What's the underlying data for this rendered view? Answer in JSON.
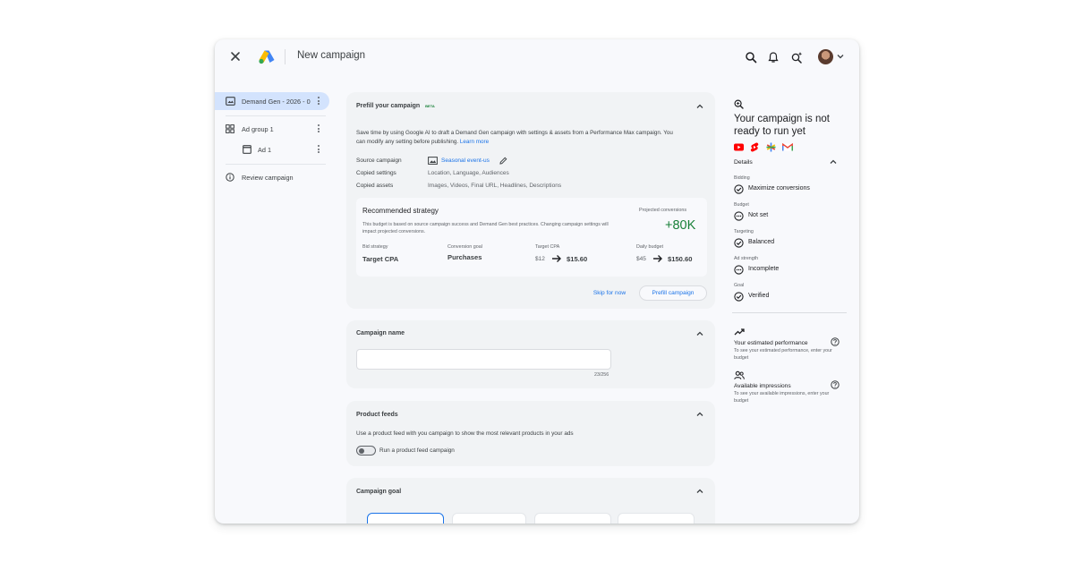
{
  "app": {
    "title": "New campaign"
  },
  "nav": {
    "items": [
      {
        "label": "Demand Gen - 2026 - 0",
        "active": true
      },
      {
        "label": "Ad group 1"
      },
      {
        "label": "Ad 1"
      },
      {
        "label": "Review campaign"
      }
    ]
  },
  "prefill": {
    "title": "Prefill your campaign",
    "badge": "BETA",
    "description": "Save time by using Google AI to draft a Demand Gen campaign with settings & assets from a Performance Max campaign. You can modify any setting before publishing.",
    "learn_more": "Learn more",
    "rows": [
      {
        "key": "Source campaign",
        "value": "Seasonal event-us"
      },
      {
        "key": "Copied settings",
        "value": "Location, Language, Audiences"
      },
      {
        "key": "Copied assets",
        "value": "Images, Videos, Final URL, Headlines, Descriptions"
      }
    ],
    "strategy": {
      "title": "Recommended strategy",
      "description": "This budget is based on source campaign success and Demand Gen best practices. Changing campaign settings will impact projected conversions.",
      "projected_label": "Projected conversions",
      "projected_value": "+80K",
      "bid_strategy_label": "Bid strategy",
      "bid_strategy_value": "Target CPA",
      "conversion_goal_label": "Conversion goal",
      "conversion_goal_value": "Purchases",
      "target_cpa_label": "Target CPA",
      "target_cpa_old": "$12",
      "target_cpa_new": "$15.60",
      "daily_budget_label": "Daily budget",
      "daily_budget_old": "$45",
      "daily_budget_new": "$150.60"
    },
    "skip_label": "Skip for now",
    "prefill_label": "Prefill campaign"
  },
  "campaign_name": {
    "title": "Campaign name",
    "value": "",
    "counter": "23/256"
  },
  "product_feeds": {
    "title": "Product feeds",
    "description": "Use a product feed with you campaign to show the most relevant products in your ads",
    "toggle_label": "Run a product feed campaign"
  },
  "campaign_goal": {
    "title": "Campaign goal"
  },
  "status_panel": {
    "title": "Your campaign is not ready to run yet",
    "details_label": "Details",
    "rows": [
      {
        "label": "Bidding",
        "value": "Maximize conversions",
        "status": "done"
      },
      {
        "label": "Budget",
        "value": "Not set",
        "status": "pending"
      },
      {
        "label": "Targeting",
        "value": "Balanced",
        "status": "done"
      },
      {
        "label": "Ad strength",
        "value": "Incomplete",
        "status": "pending"
      },
      {
        "label": "Goal",
        "value": "Verified",
        "status": "done"
      }
    ],
    "performance": {
      "title": "Your estimated performance",
      "text": "To see your estimated performance, enter your budget"
    },
    "impressions": {
      "title": "Available impressions",
      "text": "To see your available impressions, enter your budget"
    }
  },
  "colors": {
    "accent": "#1a73e8",
    "positive": "#188038",
    "nav_active": "#d3e3fd"
  }
}
